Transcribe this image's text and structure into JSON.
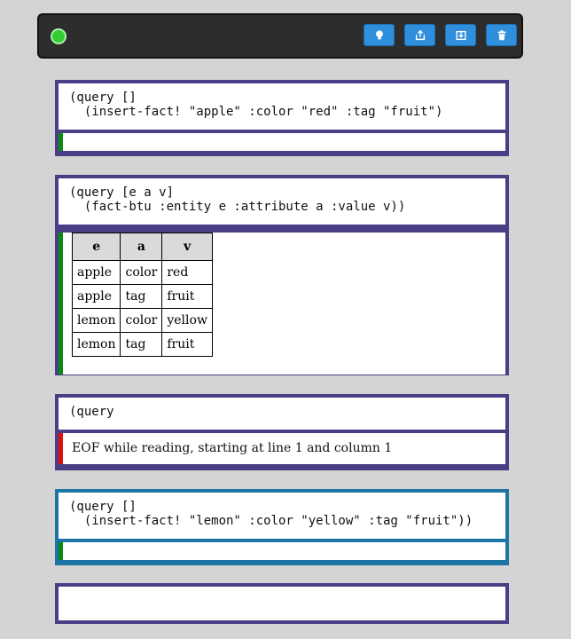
{
  "toolbar": {
    "buttons": [
      {
        "icon": "lightbulb-icon"
      },
      {
        "icon": "upload-icon"
      },
      {
        "icon": "download-icon"
      },
      {
        "icon": "trash-icon"
      }
    ]
  },
  "cells": [
    {
      "code": "(query []\n  (insert-fact! \"apple\" :color \"red\" :tag \"fruit\")"
    },
    {
      "code": "(query [e a v]\n  (fact-btu :entity e :attribute a :value v))",
      "table": {
        "headers": [
          "e",
          "a",
          "v"
        ],
        "rows": [
          [
            "apple",
            "color",
            "red"
          ],
          [
            "apple",
            "tag",
            "fruit"
          ],
          [
            "lemon",
            "color",
            "yellow"
          ],
          [
            "lemon",
            "tag",
            "fruit"
          ]
        ]
      }
    },
    {
      "code": "(query",
      "error": "EOF while reading, starting at line 1 and column 1"
    },
    {
      "code": "(query []\n  (insert-fact! \"lemon\" :color \"yellow\" :tag \"fruit\"))"
    },
    {
      "code": ""
    }
  ],
  "colors": {
    "cell_border": "#4a3f86",
    "active_border": "#1c75a5",
    "success": "#0a8a12",
    "error": "#e01010",
    "button": "#2f8fdc"
  }
}
